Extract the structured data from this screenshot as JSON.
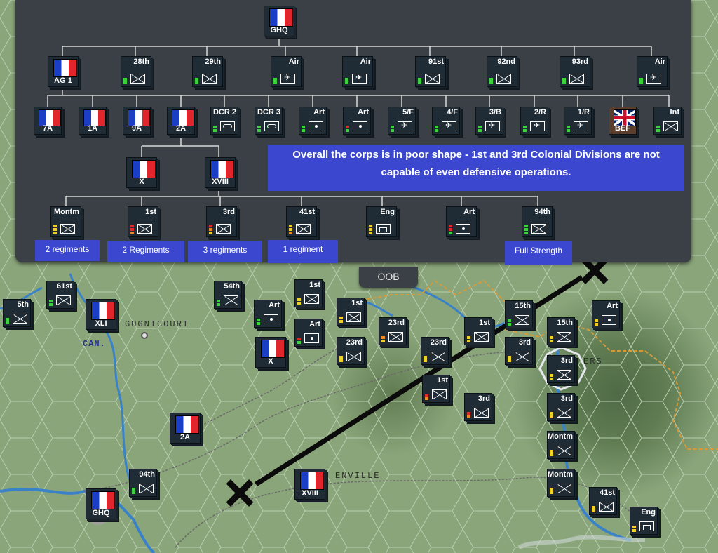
{
  "oob": {
    "tab_label": "OOB",
    "top": {
      "label": "GHQ"
    },
    "level1": [
      "AG 1",
      "28th",
      "29th",
      "Air",
      "Air",
      "91st",
      "92nd",
      "93rd",
      "Air"
    ],
    "level2": [
      "7A",
      "1A",
      "9A",
      "2A",
      "DCR 2",
      "DCR 3",
      "Art",
      "Art",
      "5/F",
      "4/F",
      "3/B",
      "2/R",
      "1/R",
      "BEF",
      "Inf"
    ],
    "level3": [
      "X",
      "XVIII"
    ],
    "level4": [
      "Montm",
      "1st",
      "3rd",
      "41st",
      "Eng",
      "Art",
      "94th"
    ],
    "notes": {
      "summary": "Overall the corps is in poor shape - 1st and 3rd Colonial Divisions are not capable of even defensive operations.",
      "montm": "2 regiments",
      "first": "2 Regiments",
      "third": "3 regiments",
      "fortyfirst": "1 regiment",
      "ninetyfourth": "Full Strength"
    }
  },
  "map": {
    "places": {
      "gugnicourt": "GUGNICOURT",
      "can": "CAN.",
      "ers": "ERS",
      "enville": "ENVILLE"
    },
    "units": [
      "5th",
      "61st",
      "XLI",
      "54th",
      "1st",
      "Art",
      "1st",
      "Art",
      "X",
      "23rd",
      "23rd",
      "1st",
      "15th",
      "15th",
      "Art",
      "23rd",
      "3rd",
      "3rd",
      "1st",
      "3rd",
      "3rd",
      "Montm",
      "Montm",
      "2A",
      "94th",
      "GHQ",
      "XVIII",
      "41st",
      "Eng"
    ]
  },
  "colors": {
    "panel": "#3b4046",
    "note": "#3b47cf",
    "counter": "#1f2c36"
  }
}
